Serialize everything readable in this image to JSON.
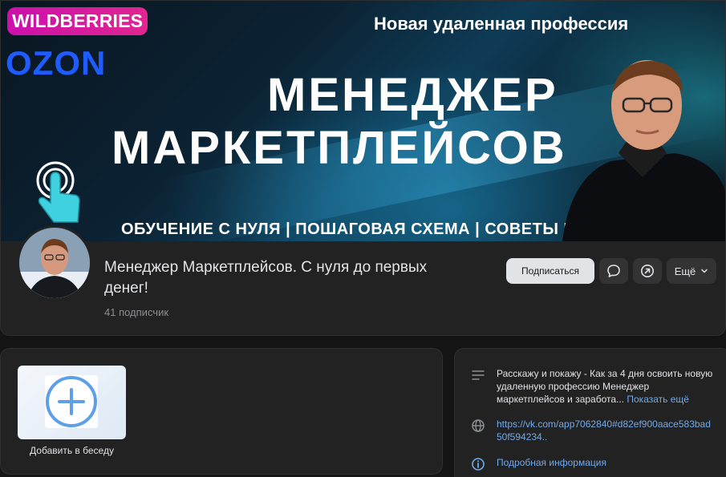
{
  "cover": {
    "logo_wb": "WILDBERRIES",
    "logo_ozon": "OZON",
    "subtitle": "Новая удаленная профессия",
    "title_line1": "МЕНЕДЖЕР",
    "title_line2": "МАРКЕТПЛЕЙСОВ",
    "tagline": "ОБУЧЕНИЕ С НУЛЯ | ПОШАГОВАЯ СХЕМА  | СОВЕТЫ И ПРАКТИКА"
  },
  "profile": {
    "name": "Менеджер Маркетплейсов. С нуля до первых денег!",
    "subscribers": "41 подписчик"
  },
  "actions": {
    "subscribe_label": "Подписаться",
    "more_label": "Ещё"
  },
  "chat_card": {
    "add_caption": "Добавить в беседу"
  },
  "info": {
    "description": "Расскажу и покажу - Как за 4 дня освоить новую удаленную профессию Менеджер маркетплейсов и заработа...",
    "show_more": "Показать ещё",
    "link": "https://vk.com/app7062840#d82ef900aace583bad50f594234..",
    "details": "Подробная информация"
  },
  "colors": {
    "accent": "#71aaeb",
    "background": "#141414",
    "card": "#222222",
    "wb_pink": "#cb11ab",
    "ozon_blue": "#1f5cff"
  },
  "icons": [
    "hand-pointer-icon",
    "message-icon",
    "share-icon",
    "chevron-down-icon",
    "text-lines-icon",
    "globe-icon",
    "info-icon",
    "plus-icon"
  ]
}
